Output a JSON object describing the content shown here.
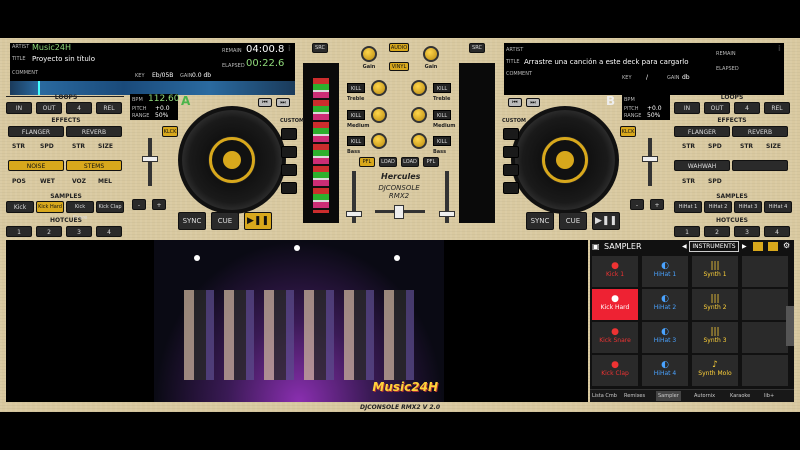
{
  "deckA": {
    "artist_label": "ARTIST",
    "artist": "Music24H",
    "title_label": "TITLE",
    "title": "Proyecto sin título",
    "comment_label": "COMMENT",
    "remain_label": "REMAIN",
    "remain": "04:00.8",
    "elapsed_label": "ELAPSED",
    "elapsed": "00:22.6",
    "key_label": "KEY",
    "key": "Eb/05B",
    "gain_label": "GAIN",
    "gain": "0.0 db",
    "bpm_label": "BPM",
    "bpm": "112.60",
    "pitch_label": "PITCH",
    "pitch": "+0.0",
    "range_label": "RANGE",
    "range": "50%",
    "letter": "A"
  },
  "deckB": {
    "artist_label": "ARTIST",
    "title_label": "TITLE",
    "title": "Arrastre una canción a este deck para cargarlo",
    "comment_label": "COMMENT",
    "remain_label": "REMAIN",
    "elapsed_label": "ELAPSED",
    "key_label": "KEY",
    "key": "/",
    "gain_label": "GAIN",
    "gain": "db",
    "bpm_label": "BPM",
    "pitch_label": "PITCH",
    "pitch": "+0.0",
    "range_label": "RANGE",
    "range": "50%",
    "letter": "B"
  },
  "left": {
    "loops": "LOOPS",
    "loop_btns": [
      "IN",
      "OUT",
      "4",
      "REL"
    ],
    "effects": "EFFECTS",
    "fx": [
      "FLANGER",
      "REVERB",
      "NOISE",
      "STEMS"
    ],
    "fx_params1": [
      "STR",
      "SPD",
      "STR",
      "SIZE"
    ],
    "fx_params2": [
      "POS",
      "WET",
      "VOZ",
      "MEL"
    ],
    "samples": "SAMPLES",
    "sample_btns": [
      "Kick",
      "Kick Hard",
      "Kick Snare",
      "Kick Clap"
    ],
    "hotcues": "HOTCUES",
    "hotcue_btns": [
      "1",
      "2",
      "3",
      "4"
    ],
    "klck": "KLCK",
    "custom": "CUSTOM",
    "sync": "SYNC",
    "cue": "CUE",
    "minus": "-",
    "plus": "+"
  },
  "right": {
    "loops": "LOOPS",
    "loop_btns": [
      "IN",
      "OUT",
      "4",
      "REL"
    ],
    "effects": "EFFECTS",
    "fx": [
      "FLANGER",
      "REVERB",
      "WAHWAH",
      ""
    ],
    "fx_params1": [
      "STR",
      "SPD",
      "STR",
      "SIZE"
    ],
    "fx_params2": [
      "STR",
      "SPD"
    ],
    "samples": "SAMPLES",
    "sample_btns": [
      "HiHat 1",
      "HiHat 2",
      "HiHat 3",
      "HiHat 4"
    ],
    "hotcues": "HOTCUES",
    "hotcue_btns": [
      "1",
      "2",
      "3",
      "4"
    ],
    "klck": "KLCK",
    "custom": "CUSTOM",
    "sync": "SYNC",
    "cue": "CUE",
    "minus": "-",
    "plus": "+"
  },
  "mixer": {
    "src": "SRC",
    "audio": "AUDIO",
    "vinyl": "VINYL",
    "gain": "Gain",
    "kill": "KILL",
    "treble": "Treble",
    "medium": "Medium",
    "bass": "Bass",
    "pfl": "PFL",
    "load": "LOAD",
    "brand": "Hercules",
    "brand2": "DJCONSOLE RMX2"
  },
  "sampler": {
    "title": "SAMPLER",
    "bank": "INSTRUMENTS",
    "pads": [
      {
        "label": "Kick 1",
        "state": "red",
        "icon": "●"
      },
      {
        "label": "HiHat 1",
        "state": "blue",
        "icon": "◐"
      },
      {
        "label": "Synth 1",
        "state": "yellow",
        "icon": "|||"
      },
      {
        "label": "",
        "state": "empty",
        "icon": ""
      },
      {
        "label": "Kick Hard",
        "state": "active",
        "icon": "●"
      },
      {
        "label": "HiHat 2",
        "state": "blue",
        "icon": "◐"
      },
      {
        "label": "Synth 2",
        "state": "yellow",
        "icon": "|||"
      },
      {
        "label": "",
        "state": "empty",
        "icon": ""
      },
      {
        "label": "Kick Snare",
        "state": "red",
        "icon": "●"
      },
      {
        "label": "HiHat 3",
        "state": "blue",
        "icon": "◐"
      },
      {
        "label": "Synth 3",
        "state": "yellow",
        "icon": "|||"
      },
      {
        "label": "",
        "state": "empty",
        "icon": ""
      },
      {
        "label": "Kick Clap",
        "state": "red",
        "icon": "●"
      },
      {
        "label": "HiHat 4",
        "state": "blue",
        "icon": "◐"
      },
      {
        "label": "Synth Molo",
        "state": "yellow",
        "icon": "♪"
      },
      {
        "label": "",
        "state": "empty",
        "icon": ""
      }
    ],
    "tabs": [
      "Lista Cmb",
      "Remixes",
      "Sampler",
      "Autornix",
      "Karaoke",
      "lib+"
    ]
  },
  "video_watermark": "Music24H",
  "footer": "DJCONSOLE RMX2 V 2.0"
}
